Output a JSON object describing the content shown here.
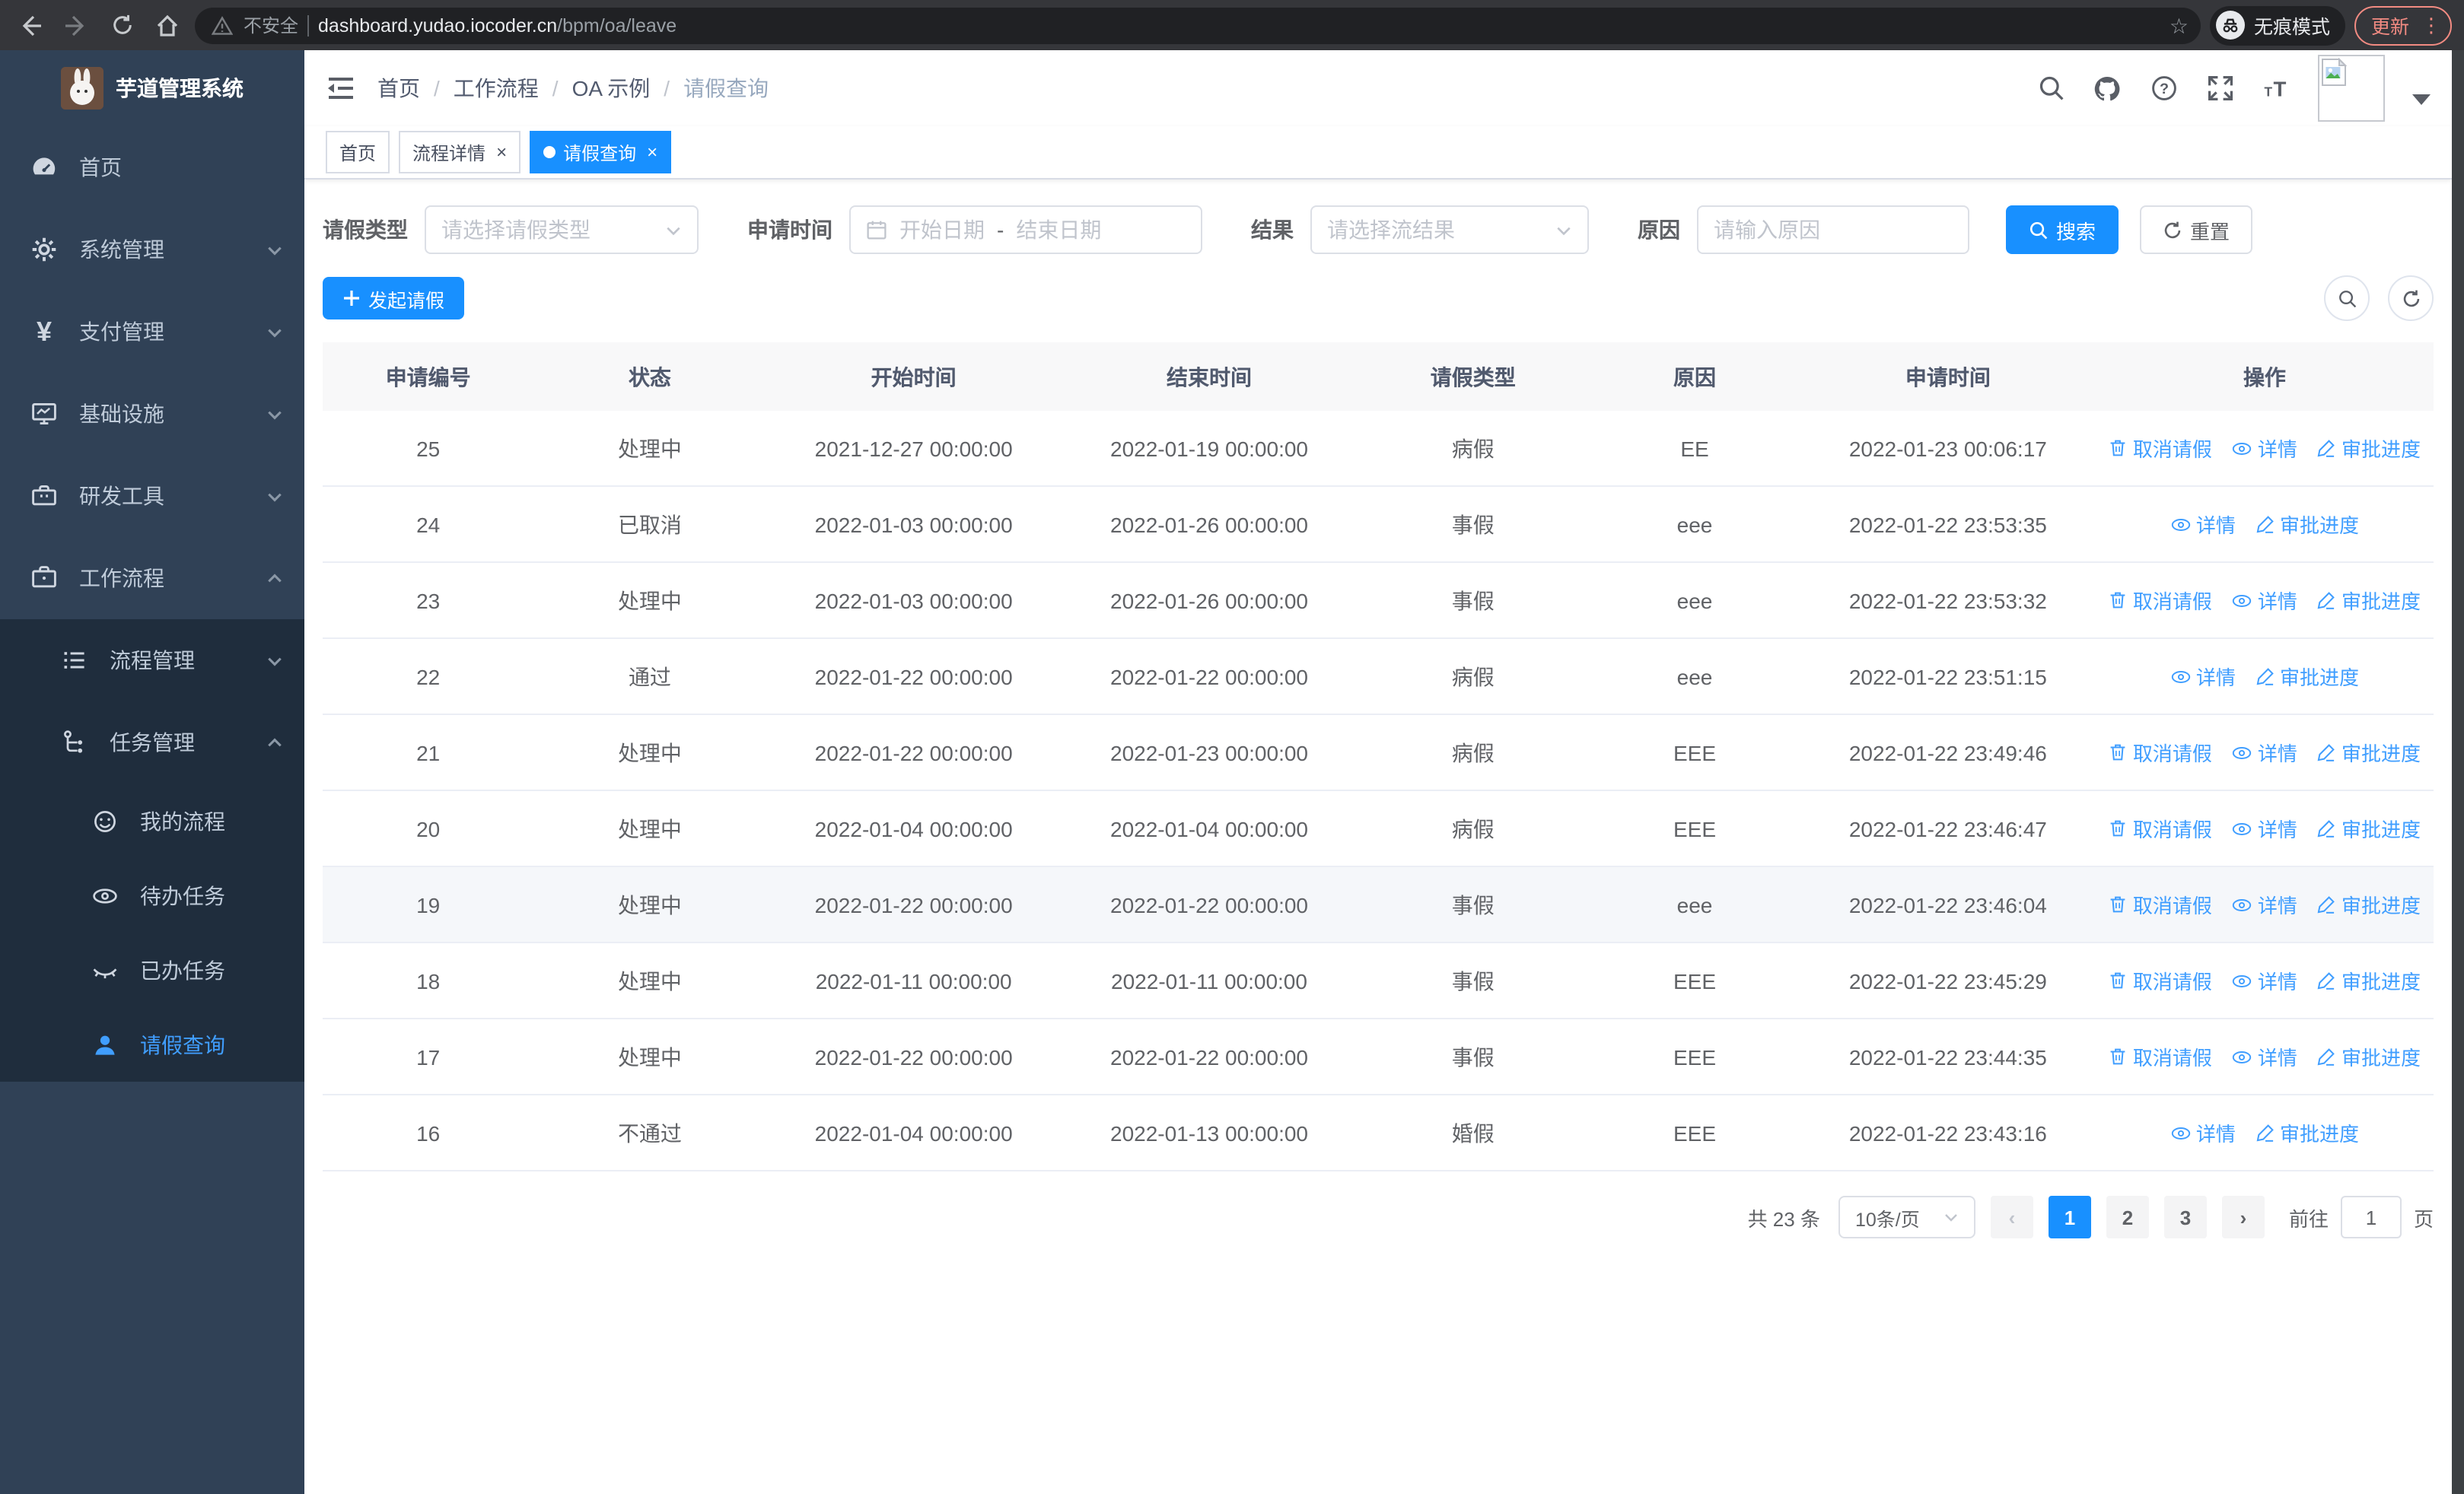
{
  "colors": {
    "primary": "#1890ff",
    "link": "#409eff",
    "sidebar_bg": "#304156",
    "submenu_bg": "#1f2d3d",
    "tag_active": "#1890ff",
    "update_accent": "#f28b82"
  },
  "browser": {
    "security_warning": "不安全",
    "url_host": "dashboard.yudao.iocoder.cn",
    "url_path": "/bpm/oa/leave",
    "incognito_label": "无痕模式",
    "update_label": "更新"
  },
  "sidebar": {
    "app_title": "芋道管理系统",
    "items": [
      {
        "label": "首页"
      },
      {
        "label": "系统管理"
      },
      {
        "label": "支付管理"
      },
      {
        "label": "基础设施"
      },
      {
        "label": "研发工具"
      },
      {
        "label": "工作流程"
      }
    ],
    "submenu": [
      {
        "label": "流程管理"
      },
      {
        "label": "任务管理"
      }
    ],
    "task_children": [
      {
        "label": "我的流程"
      },
      {
        "label": "待办任务"
      },
      {
        "label": "已办任务"
      },
      {
        "label": "请假查询"
      }
    ]
  },
  "breadcrumb": {
    "items": [
      "首页",
      "工作流程",
      "OA 示例",
      "请假查询"
    ],
    "separator": "/"
  },
  "tags": [
    {
      "label": "首页"
    },
    {
      "label": "流程详情",
      "close": "×"
    },
    {
      "label": "请假查询",
      "close": "×"
    }
  ],
  "filters": {
    "leave_type_label": "请假类型",
    "leave_type_placeholder": "请选择请假类型",
    "apply_time_label": "申请时间",
    "date_start_placeholder": "开始日期",
    "date_separator": "-",
    "date_end_placeholder": "结束日期",
    "result_label": "结果",
    "result_placeholder": "请选择流结果",
    "reason_label": "原因",
    "reason_placeholder": "请输入原因",
    "search_label": "搜索",
    "reset_label": "重置"
  },
  "toolbar": {
    "create_label": "发起请假"
  },
  "table": {
    "headers": [
      "申请编号",
      "状态",
      "开始时间",
      "结束时间",
      "请假类型",
      "原因",
      "申请时间",
      "操作"
    ],
    "actions": {
      "cancel": "取消请假",
      "detail": "详情",
      "progress": "审批进度"
    },
    "rows": [
      {
        "id": "25",
        "status": "处理中",
        "start": "2021-12-27 00:00:00",
        "end": "2022-01-19 00:00:00",
        "type": "病假",
        "reason": "EE",
        "apply": "2022-01-23 00:06:17",
        "can_cancel": true,
        "highlight": false
      },
      {
        "id": "24",
        "status": "已取消",
        "start": "2022-01-03 00:00:00",
        "end": "2022-01-26 00:00:00",
        "type": "事假",
        "reason": "eee",
        "apply": "2022-01-22 23:53:35",
        "can_cancel": false,
        "highlight": false
      },
      {
        "id": "23",
        "status": "处理中",
        "start": "2022-01-03 00:00:00",
        "end": "2022-01-26 00:00:00",
        "type": "事假",
        "reason": "eee",
        "apply": "2022-01-22 23:53:32",
        "can_cancel": true,
        "highlight": false
      },
      {
        "id": "22",
        "status": "通过",
        "start": "2022-01-22 00:00:00",
        "end": "2022-01-22 00:00:00",
        "type": "病假",
        "reason": "eee",
        "apply": "2022-01-22 23:51:15",
        "can_cancel": false,
        "highlight": false
      },
      {
        "id": "21",
        "status": "处理中",
        "start": "2022-01-22 00:00:00",
        "end": "2022-01-23 00:00:00",
        "type": "病假",
        "reason": "EEE",
        "apply": "2022-01-22 23:49:46",
        "can_cancel": true,
        "highlight": false
      },
      {
        "id": "20",
        "status": "处理中",
        "start": "2022-01-04 00:00:00",
        "end": "2022-01-04 00:00:00",
        "type": "病假",
        "reason": "EEE",
        "apply": "2022-01-22 23:46:47",
        "can_cancel": true,
        "highlight": false
      },
      {
        "id": "19",
        "status": "处理中",
        "start": "2022-01-22 00:00:00",
        "end": "2022-01-22 00:00:00",
        "type": "事假",
        "reason": "eee",
        "apply": "2022-01-22 23:46:04",
        "can_cancel": true,
        "highlight": true
      },
      {
        "id": "18",
        "status": "处理中",
        "start": "2022-01-11 00:00:00",
        "end": "2022-01-11 00:00:00",
        "type": "事假",
        "reason": "EEE",
        "apply": "2022-01-22 23:45:29",
        "can_cancel": true,
        "highlight": false
      },
      {
        "id": "17",
        "status": "处理中",
        "start": "2022-01-22 00:00:00",
        "end": "2022-01-22 00:00:00",
        "type": "事假",
        "reason": "EEE",
        "apply": "2022-01-22 23:44:35",
        "can_cancel": true,
        "highlight": false
      },
      {
        "id": "16",
        "status": "不通过",
        "start": "2022-01-04 00:00:00",
        "end": "2022-01-13 00:00:00",
        "type": "婚假",
        "reason": "EEE",
        "apply": "2022-01-22 23:43:16",
        "can_cancel": false,
        "highlight": false
      }
    ]
  },
  "pagination": {
    "total_label": "共 23 条",
    "page_size": "10条/页",
    "prev": "‹",
    "next": "›",
    "pages": [
      "1",
      "2",
      "3"
    ],
    "goto_label": "前往",
    "goto_value": "1",
    "goto_suffix": "页"
  }
}
